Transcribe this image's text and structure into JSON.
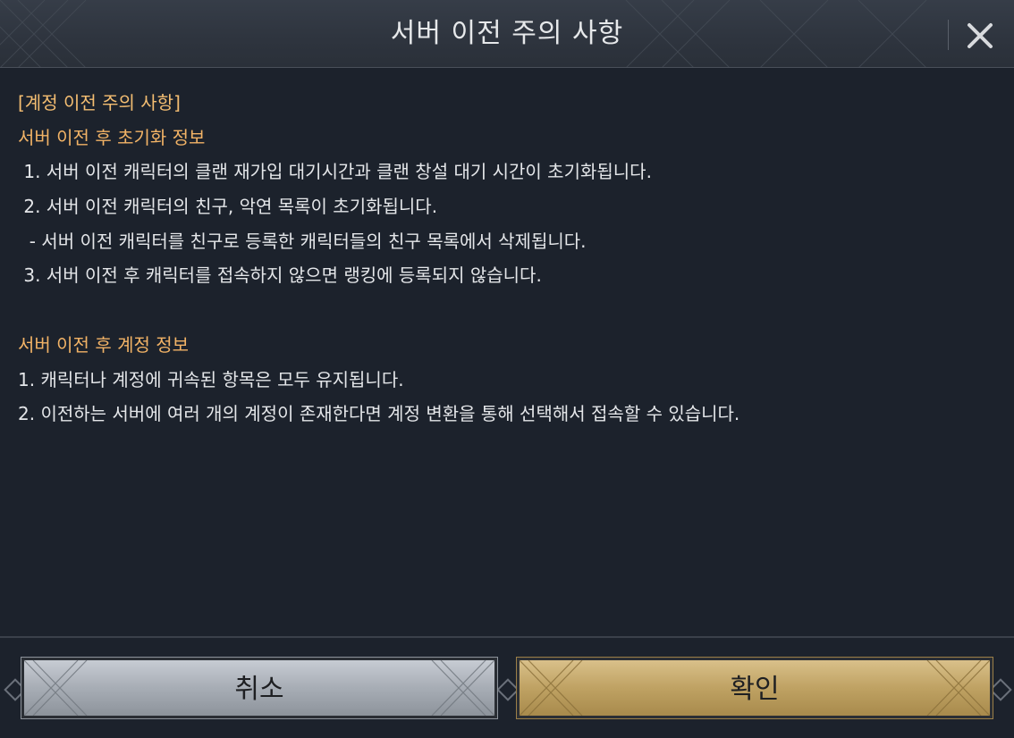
{
  "dialog": {
    "title": "서버 이전 주의 사항",
    "close_icon": "close-icon"
  },
  "content": {
    "lines": [
      {
        "text": "[계정 이전 주의 사항]",
        "kind": "section"
      },
      {
        "text": "서버 이전 후 초기화 정보",
        "kind": "accent"
      },
      {
        "text": " 1. 서버 이전 캐릭터의 클랜 재가입 대기시간과 클랜 창설 대기 시간이 초기화됩니다.",
        "kind": "normal"
      },
      {
        "text": " 2. 서버 이전 캐릭터의 친구, 악연 목록이 초기화됩니다.",
        "kind": "normal"
      },
      {
        "text": "  - 서버 이전 캐릭터를 친구로 등록한 캐릭터들의 친구 목록에서 삭제됩니다.",
        "kind": "normal"
      },
      {
        "text": " 3. 서버 이전 후 캐릭터를 접속하지 않으면 랭킹에 등록되지 않습니다.",
        "kind": "normal"
      },
      {
        "text": "",
        "kind": "blank"
      },
      {
        "text": "서버 이전 후 계정 정보",
        "kind": "accent"
      },
      {
        "text": "1. 캐릭터나 계정에 귀속된 항목은 모두 유지됩니다.",
        "kind": "normal"
      },
      {
        "text": "2. 이전하는 서버에 여러 개의 계정이 존재한다면 계정 변환을 통해 선택해서 접속할 수 있습니다.",
        "kind": "normal"
      }
    ]
  },
  "footer": {
    "cancel_label": "취소",
    "confirm_label": "확인"
  },
  "colors": {
    "background": "#1c222c",
    "section_text": "#f4be72",
    "accent_text": "#f2b366",
    "body_text": "#e4e6e9",
    "cancel_button": "#b4bac2",
    "confirm_button": "#c4a86a"
  }
}
